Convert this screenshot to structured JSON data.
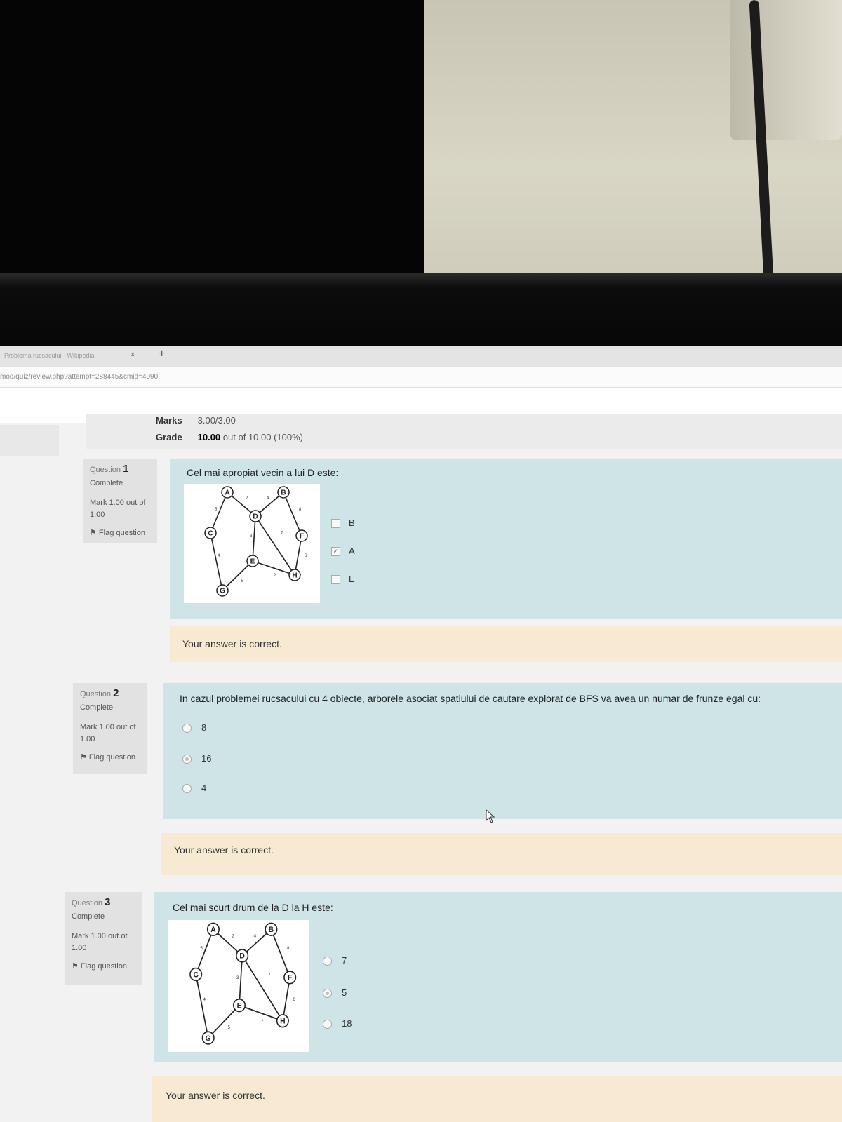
{
  "browser": {
    "tab_title": "Problema rucsacului - Wikipedia",
    "tab_close": "×",
    "new_tab": "+",
    "url": "mod/quiz/review.php?attempt=288445&cmid=4090"
  },
  "summary": {
    "marks_label": "Marks",
    "marks_value": "3.00/3.00",
    "grade_label": "Grade",
    "grade_value_bold": "10.00",
    "grade_value_rest": "out of 10.00",
    "grade_percent": "(100%)"
  },
  "common": {
    "question_word": "Question",
    "state": "Complete",
    "mark_text": "Mark 1.00 out of 1.00",
    "flag": "Flag question",
    "feedback": "Your answer is correct."
  },
  "questions": [
    {
      "number": "1",
      "text": "Cel mai apropiat vecin a lui D este:",
      "options": [
        {
          "label": "B",
          "checked": false
        },
        {
          "label": "A",
          "checked": true
        },
        {
          "label": "E",
          "checked": false
        }
      ]
    },
    {
      "number": "2",
      "text": "In cazul problemei rucsacului cu 4 obiecte, arborele asociat spatiului de cautare explorat de BFS va avea un numar de frunze egal cu:",
      "options": [
        {
          "label": "8",
          "checked": false
        },
        {
          "label": "16",
          "checked": true
        },
        {
          "label": "4",
          "checked": false
        }
      ]
    },
    {
      "number": "3",
      "text": "Cel mai scurt drum de la D la H este:",
      "options": [
        {
          "label": "7",
          "checked": false
        },
        {
          "label": "5",
          "checked": true
        },
        {
          "label": "18",
          "checked": false
        }
      ]
    }
  ],
  "graph": {
    "nodes": [
      "A",
      "B",
      "C",
      "D",
      "E",
      "F",
      "G",
      "H"
    ],
    "weights": [
      "5",
      "2",
      "4",
      "8",
      "3",
      "7",
      "4",
      "6",
      "5",
      "2"
    ]
  }
}
